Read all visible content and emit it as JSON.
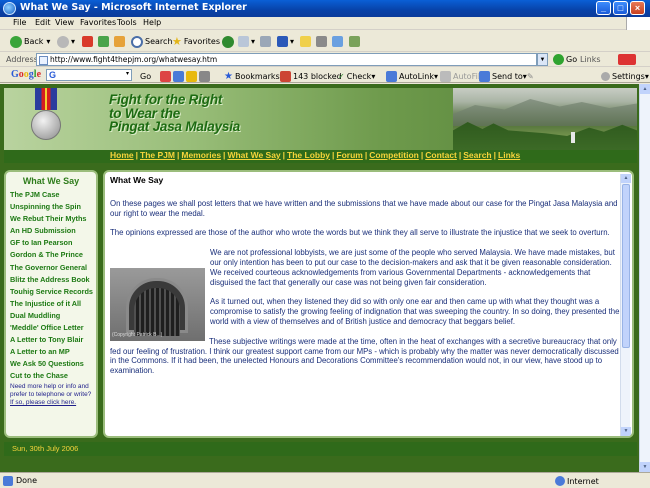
{
  "window": {
    "title": "What We Say - Microsoft Internet Explorer"
  },
  "menu": [
    "File",
    "Edit",
    "View",
    "Favorites",
    "Tools",
    "Help"
  ],
  "toolbar": {
    "back": "Back",
    "search": "Search",
    "favorites": "Favorites"
  },
  "address": {
    "label": "Address",
    "url": "http://www.fight4thepjm.org/whatwesay.htm",
    "go": "Go",
    "links": "Links"
  },
  "googlebar": {
    "logo": "Google",
    "go": "Go",
    "bookmarks": "Bookmarks",
    "blocked": "143 blocked",
    "check": "Check",
    "autolink": "AutoLink",
    "autofill": "AutoFill",
    "sendto": "Send to",
    "settings": "Settings"
  },
  "site": {
    "heading": [
      "Fight for the Right",
      "to Wear the",
      "Pingat Jasa Malaysia"
    ],
    "nav": [
      "Home",
      "The PJM",
      "Memories",
      "What We Say",
      "The Lobby",
      "Forum",
      "Competition",
      "Contact",
      "Search",
      "Links"
    ],
    "sidebar_title": "What We Say",
    "sidebar_items": [
      "The PJM Case",
      "Unspinning the Spin",
      "We Rebut Their Myths",
      "An HD Submission",
      "GF to Ian Pearson",
      "Gordon & The Prince",
      "The Governor General",
      "Blitz the Address Book",
      "Touhig Service Records",
      "The Injustice of it All",
      "Dual Muddling",
      "'Meddle' Office Letter",
      "A Letter to Tony Blair",
      "A Letter to an MP",
      "We Ask 50 Questions",
      "Cut to the Chase"
    ],
    "help_text": "Need more help or info and prefer to telephone or write?",
    "help_link": "If so, please click here.",
    "image_caption": "(Copyright Patrick B...)",
    "content_title": "What We Say",
    "paragraphs": [
      "On these pages we shall post letters that we have written and the submissions that we have made about our case for the Pingat Jasa Malaysia and our right to wear the medal.",
      "The opinions expressed are those of the author who wrote the words but we think they all serve to illustrate the injustice that we seek to overturn.",
      "We are not professional lobbyists, we are just some of the people who served Malaysia. We have made mistakes, but our only intention has been to put our case to the decision-makers and ask that it be given reasonable consideration. We received courteous acknowledgements from various Governmental Departments - acknowledgements that disguised the fact that generally our case was not being given fair consideration.",
      "As it turned out, when they listened they did so with only one ear and then came up with what they thought was a compromise to satisfy the growing feeling of indignation that was sweeping the country. In so doing, they presented the world with a view of themselves and of British justice and democracy that beggars belief.",
      "These subjective writings were made at the time, often in the heat of exchanges with a secretive bureaucracy that only fed our feeling of frustration. I think our greatest support came from our MPs - which is probably why the matter was never democratically discussed in the Commons. If it had been, the unelected Honours and Decorations Committee's recommendation would not, in our view, have stood up to examination."
    ],
    "footer_date": "Sun, 30th July 2006"
  },
  "status": {
    "text": "Done",
    "zone": "Internet"
  },
  "colors": {
    "page_bg": "#3a6b1c",
    "nav_text": "#f6d43b",
    "sidebar_link": "#1e7a14",
    "body_text": "#1a2f7a"
  }
}
